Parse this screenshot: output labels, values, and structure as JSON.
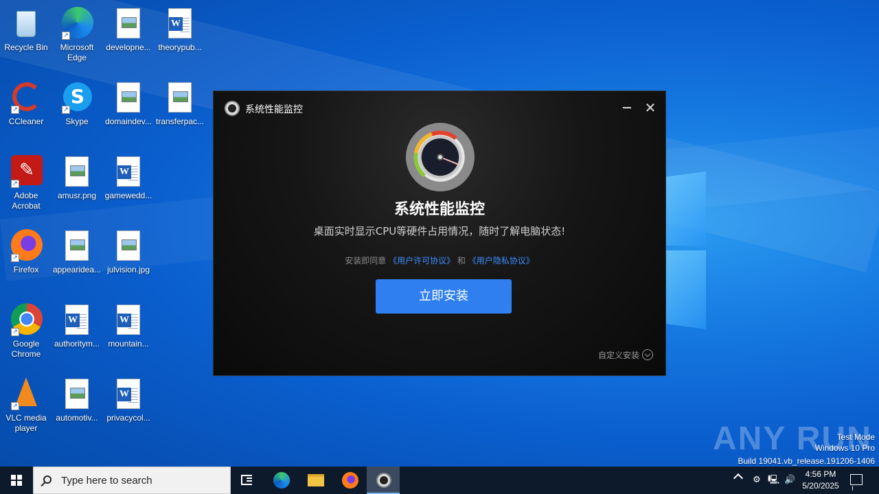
{
  "desktop": {
    "icons": [
      {
        "label": "Recycle Bin",
        "kind": "recycle-bin"
      },
      {
        "label": "Microsoft Edge",
        "kind": "edge"
      },
      {
        "label": "developne...",
        "kind": "image"
      },
      {
        "label": "theorypub...",
        "kind": "word"
      },
      {
        "label": "CCleaner",
        "kind": "ccleaner"
      },
      {
        "label": "Skype",
        "kind": "skype"
      },
      {
        "label": "domaindev...",
        "kind": "image"
      },
      {
        "label": "transferpac...",
        "kind": "image"
      },
      {
        "label": "Adobe Acrobat",
        "kind": "acrobat"
      },
      {
        "label": "amusr.png",
        "kind": "image"
      },
      {
        "label": "gamewedd...",
        "kind": "word"
      },
      {
        "label": "Firefox",
        "kind": "firefox"
      },
      {
        "label": "appearidea...",
        "kind": "image"
      },
      {
        "label": "julvision.jpg",
        "kind": "image"
      },
      {
        "label": "Google Chrome",
        "kind": "chrome"
      },
      {
        "label": "authoritym...",
        "kind": "word"
      },
      {
        "label": "mountain...",
        "kind": "word"
      },
      {
        "label": "VLC media player",
        "kind": "vlc"
      },
      {
        "label": "automotiv...",
        "kind": "image"
      },
      {
        "label": "privacycol...",
        "kind": "word"
      }
    ]
  },
  "installer": {
    "title": "系统性能监控",
    "app_name": "系统性能监控",
    "tagline": "桌面实时显示CPU等硬件占用情况，随时了解电脑状态!",
    "agree_prefix": "安装即同意",
    "license_link": "《用户许可协议》",
    "agree_and": "和",
    "privacy_link": "《用户隐私协议》",
    "install_button": "立即安装",
    "custom_install": "自定义安装",
    "minimize_icon": "minimize-icon",
    "close_icon": "close-icon",
    "accent": "#2f7ff0"
  },
  "watermark": {
    "brand": "ANY RUN",
    "line1": "Test Mode",
    "line2": "Windows 10 Pro",
    "line3": "Build 19041.vb_release.191206-1406"
  },
  "taskbar": {
    "search_placeholder": "Type here to search",
    "apps": [
      "task-view",
      "edge",
      "file-explorer",
      "firefox",
      "system-monitor"
    ],
    "clock_time": "4:56 PM",
    "clock_date": "5/20/2025"
  }
}
